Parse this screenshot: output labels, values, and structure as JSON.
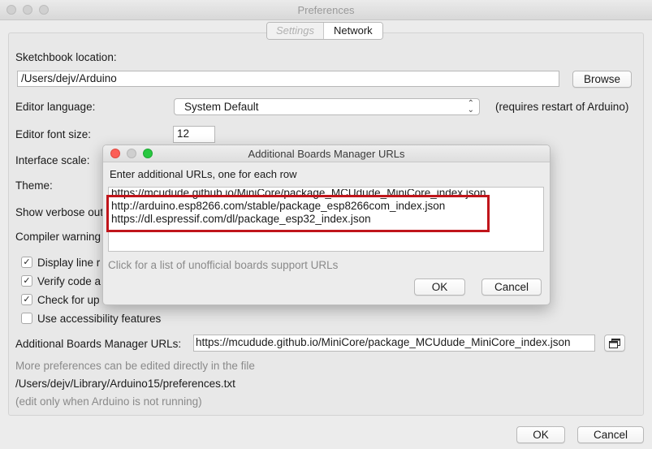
{
  "window": {
    "title": "Preferences"
  },
  "tabs": [
    {
      "label": "Settings"
    },
    {
      "label": "Network"
    }
  ],
  "prefs": {
    "sketchbook_label": "Sketchbook location:",
    "sketchbook_value": "/Users/dejv/Arduino",
    "browse_label": "Browse",
    "editor_language_label": "Editor language:",
    "editor_language_value": "System Default",
    "restart_note": "(requires restart of Arduino)",
    "font_size_label": "Editor font size:",
    "font_size_value": "12",
    "interface_scale_label": "Interface scale:",
    "theme_label": "Theme:",
    "verbose_label": "Show verbose out",
    "compiler_warnings_label": "Compiler warning",
    "checkboxes": [
      {
        "label": "Display line r",
        "checked": true
      },
      {
        "label": "Verify code a",
        "checked": true
      },
      {
        "label": "Check for up",
        "checked": true
      },
      {
        "label": "Use accessibility features",
        "checked": false
      }
    ],
    "boards_urls_label": "Additional Boards Manager URLs:",
    "boards_urls_value": "https://mcudude.github.io/MiniCore/package_MCUdude_MiniCore_index.json",
    "more_prefs_note": "More preferences can be edited directly in the file",
    "prefs_path": "/Users/dejv/Library/Arduino15/preferences.txt",
    "edit_note": "(edit only when Arduino is not running)",
    "ok_label": "OK",
    "cancel_label": "Cancel"
  },
  "dialog": {
    "title": "Additional Boards Manager URLs",
    "instruction": "Enter additional URLs, one for each row",
    "urls": [
      "https://mcudude.github.io/MiniCore/package_MCUdude_MiniCore_index.json",
      "http://arduino.esp8266.com/stable/package_esp8266com_index.json",
      "https://dl.espressif.com/dl/package_esp32_index.json"
    ],
    "unofficial_link": "Click for a list of unofficial boards support URLs",
    "ok_label": "OK",
    "cancel_label": "Cancel"
  },
  "colors": {
    "highlight": "#c0151b",
    "close": "#fc5f57",
    "minimize": "#c9c9c9",
    "maximize": "#28c840"
  }
}
